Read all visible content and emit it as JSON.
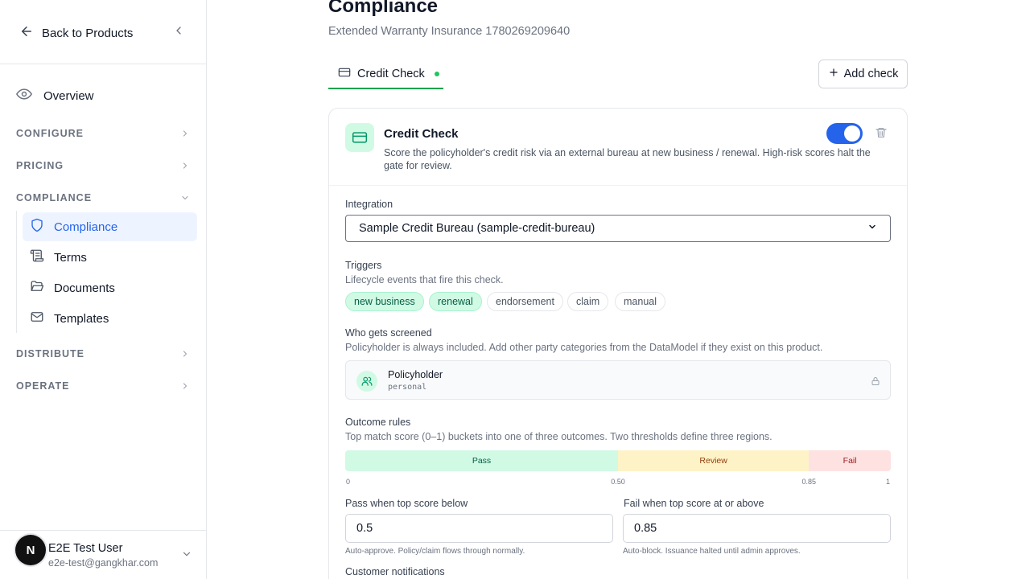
{
  "sidebar": {
    "back_label": "Back to Products",
    "overview_label": "Overview",
    "sections": {
      "configure": "CONFIGURE",
      "pricing": "PRICING",
      "compliance": "COMPLIANCE",
      "distribute": "DISTRIBUTE",
      "operate": "OPERATE"
    },
    "compliance_items": [
      "Compliance",
      "Terms",
      "Documents",
      "Templates"
    ],
    "active_item": "Compliance",
    "user": {
      "initial": "N",
      "name": "E2E Test User",
      "email": "e2e-test@gangkhar.com"
    }
  },
  "header": {
    "title": "Compliance",
    "subtitle": "Extended Warranty Insurance 1780269209640"
  },
  "tabs": [
    {
      "label": "Credit Check",
      "active": true
    }
  ],
  "add_check_label": "Add check",
  "check": {
    "title": "Credit Check",
    "description": "Score the policyholder's credit risk via an external bureau at new business / renewal. High-risk scores halt the gate for review.",
    "enabled": true,
    "integration": {
      "label": "Integration",
      "value": "Sample Credit Bureau (sample-credit-bureau)"
    },
    "triggers": {
      "label": "Triggers",
      "help": "Lifecycle events that fire this check.",
      "options": [
        {
          "label": "new business",
          "on": true
        },
        {
          "label": "renewal",
          "on": true
        },
        {
          "label": "endorsement",
          "on": false
        },
        {
          "label": "claim",
          "on": false
        },
        {
          "label": "manual",
          "on": false
        }
      ]
    },
    "screened": {
      "label": "Who gets screened",
      "help": "Policyholder is always included. Add other party categories from the DataModel if they exist on this product.",
      "party_name": "Policyholder",
      "party_type": "personal"
    },
    "outcome": {
      "label": "Outcome rules",
      "help": "Top match score (0–1) buckets into one of three outcomes. Two thresholds define three regions.",
      "pass_label": "Pass",
      "review_label": "Review",
      "fail_label": "Fail",
      "pass_threshold": 0.5,
      "fail_threshold": 0.85,
      "ticks": [
        "0",
        "0.50",
        "0.85",
        "1"
      ],
      "pass_input_label": "Pass when top score below",
      "pass_input_value": "0.5",
      "pass_input_help": "Auto-approve. Policy/claim flows through normally.",
      "fail_input_label": "Fail when top score at or above",
      "fail_input_value": "0.85",
      "fail_input_help": "Auto-block. Issuance halted until admin approves."
    },
    "notifications_label": "Customer notifications"
  },
  "colors": {
    "accent": "#2563eb",
    "success": "#16a34a",
    "pass": "#d1fae5",
    "review": "#fef3c7",
    "fail": "#fee2e2"
  }
}
